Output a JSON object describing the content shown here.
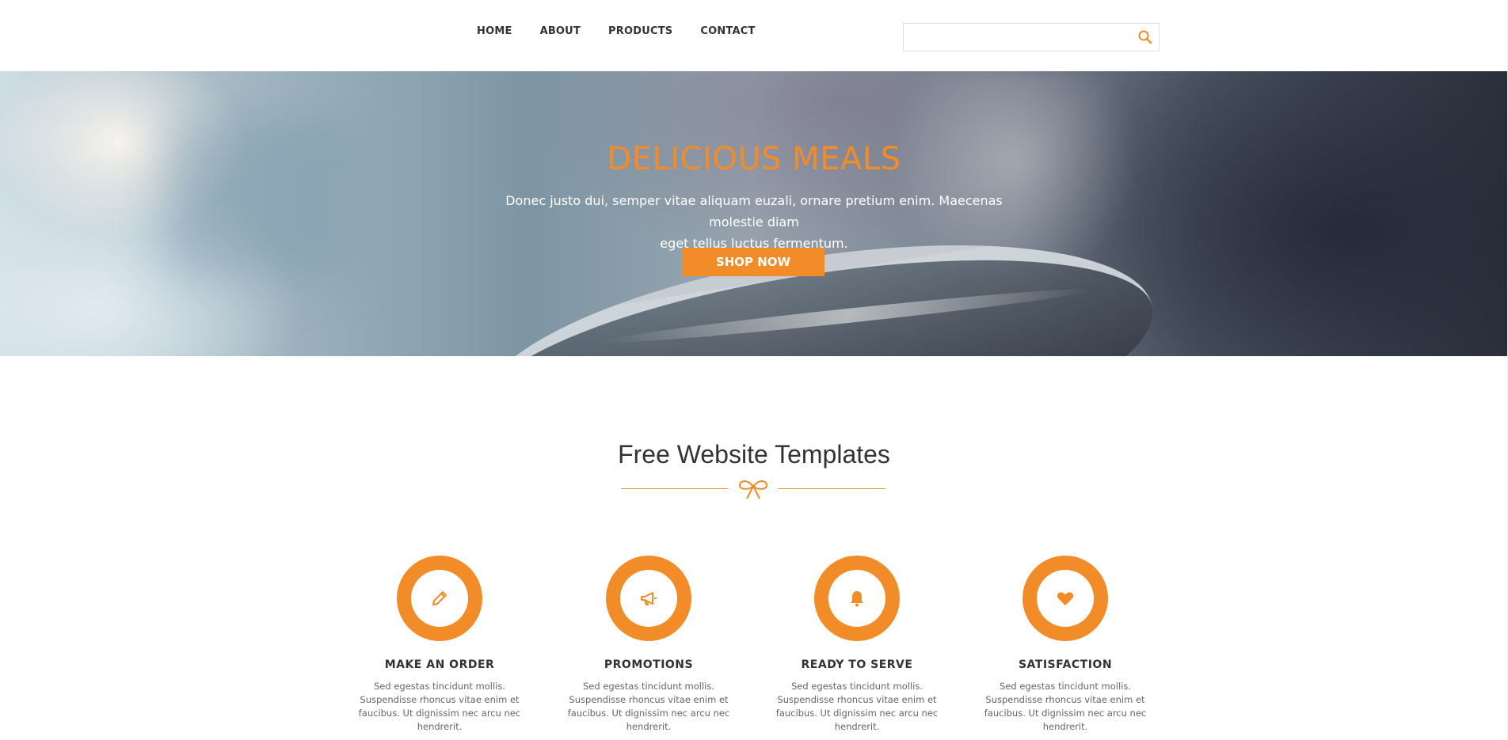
{
  "nav": {
    "items": [
      {
        "label": "HOME"
      },
      {
        "label": "ABOUT"
      },
      {
        "label": "PRODUCTS"
      },
      {
        "label": "CONTACT"
      }
    ]
  },
  "search": {
    "value": "",
    "placeholder": "",
    "icon": "search-icon"
  },
  "hero": {
    "title": "DELICIOUS MEALS",
    "text_line1": "Donec justo dui, semper vitae aliquam euzali, ornare pretium enim. Maecenas molestie diam",
    "text_line2": "eget tellus luctus fermentum.",
    "button_label": "SHOP NOW"
  },
  "section": {
    "title": "Free Website Templates",
    "divider_icon": "bow-icon"
  },
  "features": [
    {
      "icon": "pencil-icon",
      "title": "MAKE AN ORDER",
      "text": "Sed egestas tincidunt mollis. Suspendisse rhoncus vitae enim et faucibus. Ut dignissim nec arcu nec hendrerit."
    },
    {
      "icon": "megaphone-icon",
      "title": "PROMOTIONS",
      "text": "Sed egestas tincidunt mollis. Suspendisse rhoncus vitae enim et faucibus. Ut dignissim nec arcu nec hendrerit."
    },
    {
      "icon": "bell-icon",
      "title": "READY TO SERVE",
      "text": "Sed egestas tincidunt mollis. Suspendisse rhoncus vitae enim et faucibus. Ut dignissim nec arcu nec hendrerit."
    },
    {
      "icon": "heart-icon",
      "title": "SATISFACTION",
      "text": "Sed egestas tincidunt mollis. Suspendisse rhoncus vitae enim et faucibus. Ut dignissim nec arcu nec hendrerit."
    }
  ],
  "colors": {
    "accent": "#f28c28",
    "text_dark": "#333333",
    "text_body": "#666666"
  }
}
